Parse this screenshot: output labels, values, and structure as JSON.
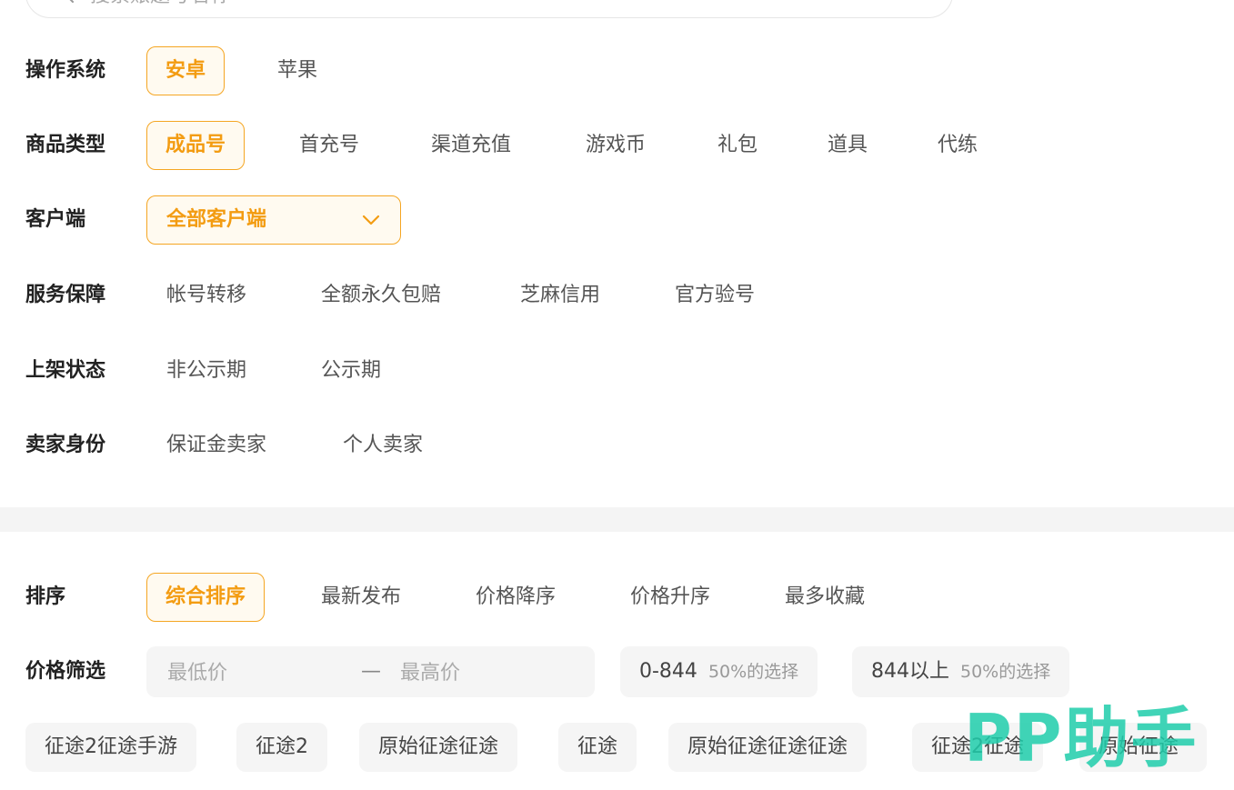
{
  "search": {
    "placeholder": "搜索账题号名称"
  },
  "filters": {
    "os": {
      "label": "操作系统",
      "options": [
        "安卓",
        "苹果"
      ],
      "selected": "安卓"
    },
    "goods_type": {
      "label": "商品类型",
      "options": [
        "成品号",
        "首充号",
        "渠道充值",
        "游戏币",
        "礼包",
        "道具",
        "代练"
      ],
      "selected": "成品号"
    },
    "client": {
      "label": "客户端",
      "selected": "全部客户端"
    },
    "service": {
      "label": "服务保障",
      "options": [
        "帐号转移",
        "全额永久包赔",
        "芝麻信用",
        "官方验号"
      ]
    },
    "listing_status": {
      "label": "上架状态",
      "options": [
        "非公示期",
        "公示期"
      ]
    },
    "seller": {
      "label": "卖家身份",
      "options": [
        "保证金卖家",
        "个人卖家"
      ]
    }
  },
  "sort": {
    "label": "排序",
    "options": [
      "综合排序",
      "最新发布",
      "价格降序",
      "价格升序",
      "最多收藏"
    ],
    "selected": "综合排序"
  },
  "price": {
    "label": "价格筛选",
    "min_placeholder": "最低价",
    "max_placeholder": "最高价",
    "dash": "—",
    "ranges": [
      {
        "range": "0-844",
        "note": "50%的选择"
      },
      {
        "range": "844以上",
        "note": "50%的选择"
      }
    ]
  },
  "tags": [
    "征途2征途手游",
    "征途2",
    "原始征途征途",
    "征途",
    "原始征途征途征途",
    "征途2征途",
    "原始征途"
  ],
  "watermark": "PP助手",
  "colors": {
    "accent": "#f39c12",
    "accent_border": "#f5a623",
    "chip_bg": "#f5f5f5",
    "watermark": "#1ecdaa"
  }
}
